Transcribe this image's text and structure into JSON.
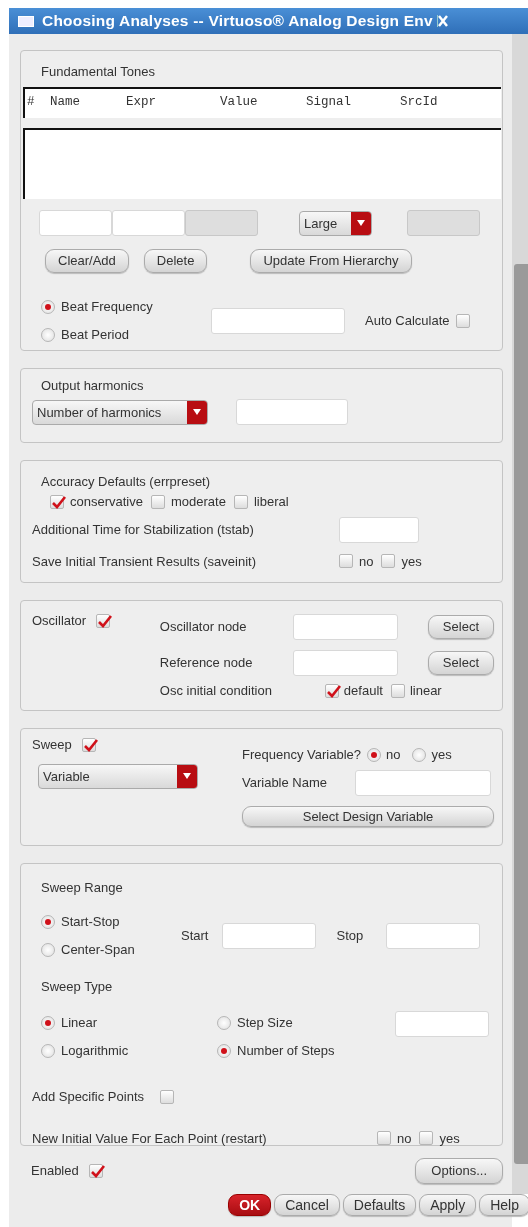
{
  "window": {
    "title": "Choosing Analyses -- Virtuoso® Analog Design Env"
  },
  "fundamental_tones": {
    "title": "Fundamental Tones",
    "columns": [
      "#",
      "Name",
      "Expr",
      "Value",
      "Signal",
      "SrcId"
    ],
    "fields": [
      {
        "disabled": false
      },
      {
        "disabled": false
      },
      {
        "disabled": true
      }
    ],
    "size_select": {
      "value": "Large"
    },
    "srcid_field": {
      "disabled": true
    },
    "buttons": [
      "Clear/Add",
      "Delete",
      "Update From Hierarchy"
    ],
    "beat": [
      {
        "label": "Beat Frequency",
        "selected": true
      },
      {
        "label": "Beat Period",
        "selected": false
      }
    ],
    "auto_calculate": {
      "label": "Auto Calculate",
      "checked": false
    }
  },
  "output_harmonics": {
    "title": "Output harmonics",
    "select": {
      "value": "Number of harmonics"
    }
  },
  "accuracy": {
    "title": "Accuracy Defaults (errpreset)",
    "options": [
      {
        "label": "conservative",
        "checked": true
      },
      {
        "label": "moderate",
        "checked": false
      },
      {
        "label": "liberal",
        "checked": false
      }
    ],
    "tstab_label": "Additional Time for Stabilization (tstab)",
    "saveinit": {
      "label": "Save Initial Transient Results (saveinit)",
      "options": [
        {
          "label": "no",
          "checked": false
        },
        {
          "label": "yes",
          "checked": false
        }
      ]
    }
  },
  "oscillator": {
    "label": "Oscillator",
    "checked": true,
    "nodes": [
      {
        "label": "Oscillator node",
        "button": "Select"
      },
      {
        "label": "Reference node",
        "button": "Select"
      }
    ],
    "initial_condition": {
      "label": "Osc initial condition",
      "options": [
        {
          "label": "default",
          "checked": true
        },
        {
          "label": "linear",
          "checked": false
        }
      ]
    }
  },
  "sweep": {
    "label": "Sweep",
    "checked": true,
    "select": {
      "value": "Variable"
    },
    "frequency_variable": {
      "label": "Frequency Variable?",
      "options": [
        {
          "label": "no",
          "selected": true
        },
        {
          "label": "yes",
          "selected": false
        }
      ]
    },
    "variable_name_label": "Variable Name",
    "button": "Select Design Variable"
  },
  "sweep_range": {
    "title": "Sweep Range",
    "modes": [
      {
        "label": "Start-Stop",
        "selected": true
      },
      {
        "label": "Center-Span",
        "selected": false
      }
    ],
    "start_label": "Start",
    "stop_label": "Stop",
    "type_title": "Sweep Type",
    "types": [
      {
        "label": "Linear",
        "selected": true
      },
      {
        "label": "Logarithmic",
        "selected": false
      }
    ],
    "step_modes": [
      {
        "label": "Step Size",
        "selected": false
      },
      {
        "label": "Number of Steps",
        "selected": true
      }
    ],
    "specific_points": {
      "label": "Add Specific Points",
      "checked": false
    },
    "restart": {
      "label": "New Initial Value For Each Point (restart)",
      "options": [
        {
          "label": "no",
          "checked": false
        },
        {
          "label": "yes",
          "checked": false
        }
      ]
    }
  },
  "enabled": {
    "label": "Enabled",
    "checked": true
  },
  "options_button": "Options...",
  "footer_buttons": [
    {
      "label": "OK",
      "kind": "primary"
    },
    {
      "label": "Cancel",
      "kind": "normal"
    },
    {
      "label": "Defaults",
      "kind": "normal"
    },
    {
      "label": "Apply",
      "kind": "normal"
    },
    {
      "label": "Help",
      "kind": "normal"
    }
  ]
}
